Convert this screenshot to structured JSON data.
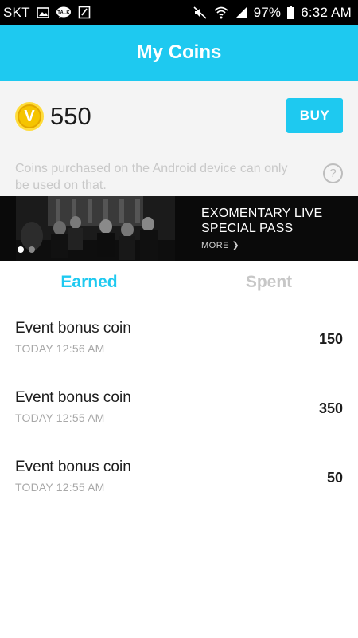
{
  "status_bar": {
    "carrier": "SKT",
    "battery": "97%",
    "time": "6:32 AM",
    "icons": [
      "gallery-icon",
      "talk-icon",
      "note-icon",
      "mute-icon",
      "wifi-icon",
      "signal-icon",
      "battery-icon"
    ]
  },
  "header": {
    "title": "My Coins"
  },
  "balance": {
    "coin_letter": "V",
    "amount": "550",
    "buy_label": "BUY",
    "accent": "#1ec9f0"
  },
  "note": {
    "text": "Coins purchased on the Android device can only be used on that.",
    "help_symbol": "?"
  },
  "banner": {
    "line1": "EXOMENTARY LIVE",
    "line2": "SPECIAL PASS",
    "more": "MORE ❯",
    "dots": 2,
    "active_dot": 0
  },
  "tabs": {
    "earned": "Earned",
    "spent": "Spent",
    "active": "earned"
  },
  "transactions": [
    {
      "title": "Event bonus coin",
      "time": "TODAY 12:56 AM",
      "amount": "150"
    },
    {
      "title": "Event bonus coin",
      "time": "TODAY 12:55 AM",
      "amount": "350"
    },
    {
      "title": "Event bonus coin",
      "time": "TODAY 12:55 AM",
      "amount": "50"
    }
  ]
}
